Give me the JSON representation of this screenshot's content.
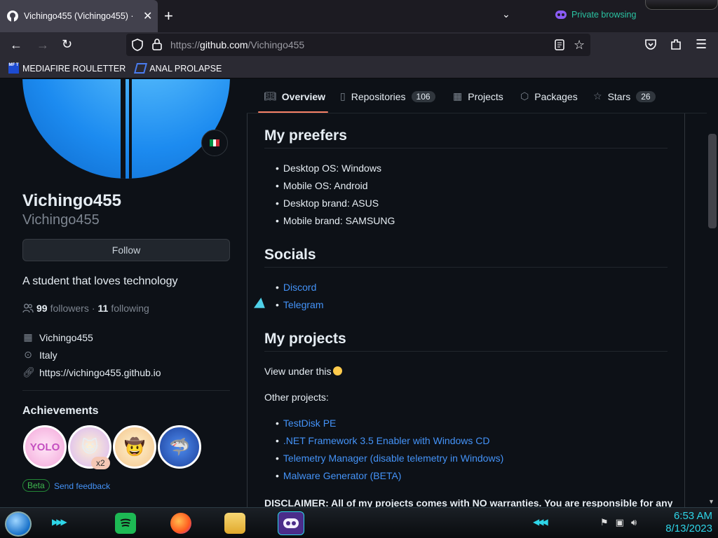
{
  "browser": {
    "tab_title": "Vichingo455 (Vichingo455) · GitHub",
    "private_label": "Private browsing",
    "url_prefix": "https://",
    "url_host": "github.com",
    "url_path": "/Vichingo455",
    "bookmarks": [
      {
        "label": "MEDIAFIRE ROULETTER",
        "icon_text": "MF T"
      },
      {
        "label": "ANAL PROLAPSE"
      }
    ]
  },
  "profile": {
    "name": "Vichingo455",
    "login": "Vichingo455",
    "follow_label": "Follow",
    "bio": "A student that loves technology",
    "followers_count": "99",
    "followers_label": "followers",
    "following_count": "11",
    "following_label": "following",
    "separator": "·",
    "company": "Vichingo455",
    "location": "Italy",
    "website": "https://vichingo455.github.io",
    "achievements_title": "Achievements",
    "achievement_multiplier": "x2",
    "beta_label": "Beta",
    "feedback_label": "Send feedback"
  },
  "tabs": [
    {
      "label": "Overview"
    },
    {
      "label": "Repositories",
      "count": "106"
    },
    {
      "label": "Projects"
    },
    {
      "label": "Packages"
    },
    {
      "label": "Stars",
      "count": "26"
    }
  ],
  "readme": {
    "section1_title": "My preefers",
    "preferences": [
      "Desktop OS: Windows",
      "Mobile OS: Android",
      "Desktop brand: ASUS",
      "Mobile brand: SAMSUNG"
    ],
    "section2_title": "Socials",
    "socials": [
      "Discord",
      "Telegram"
    ],
    "section3_title": "My projects",
    "view_text": "View under this",
    "other_projects": "Other projects:",
    "projects": [
      "TestDisk PE",
      ".NET Framework 3.5 Enabler with Windows CD",
      "Telemetry Manager (disable telemetry in Windows)",
      "Malware Generator (BETA)"
    ],
    "disclaimer": "DISCLAIMER: All of my projects comes with NO warranties. You are responsible for any"
  },
  "taskbar": {
    "time": "6:53 AM",
    "date": "8/13/2023"
  },
  "colors": {
    "accent_link": "#4493f8",
    "tab_underline": "#f78166",
    "private_teal": "#2ac3a2",
    "clock_cyan": "#2ed5e8"
  }
}
